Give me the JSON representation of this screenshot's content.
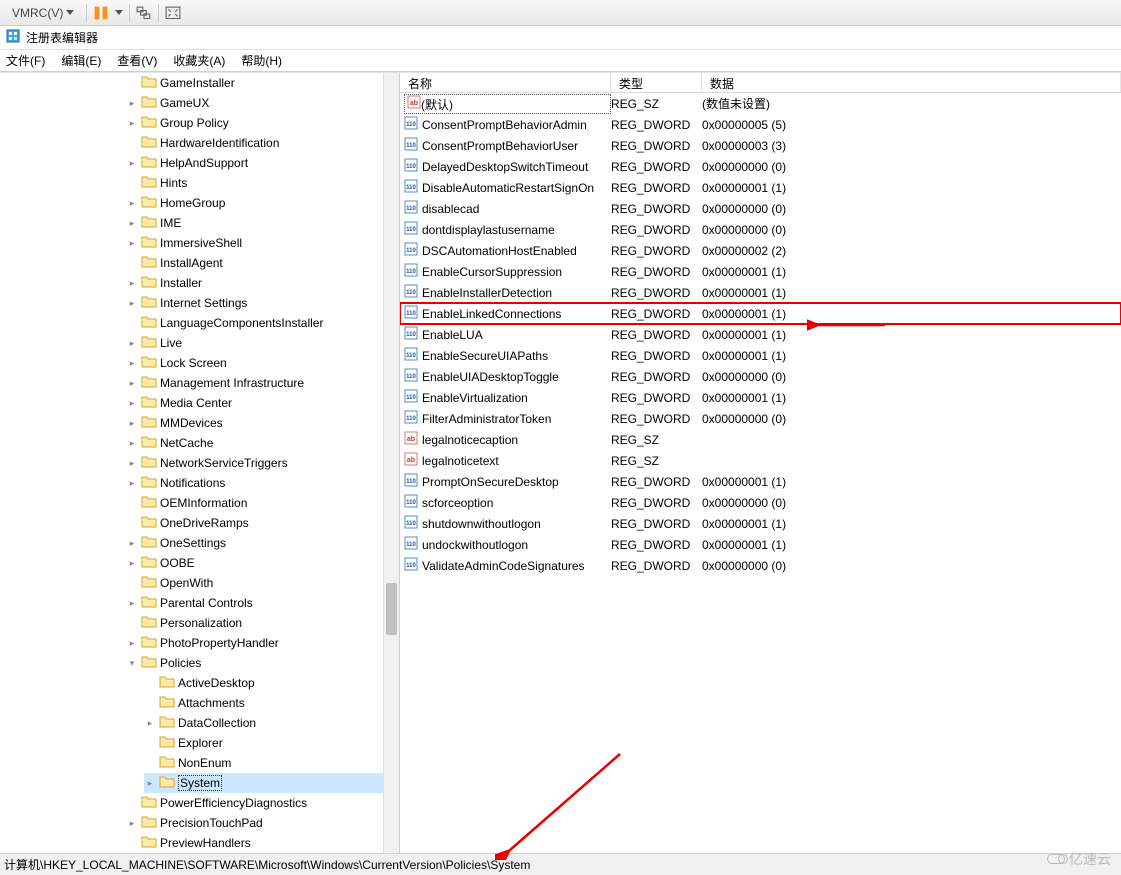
{
  "vmrc": {
    "label": "VMRC(V)"
  },
  "window": {
    "title": "注册表编辑器"
  },
  "menu": {
    "file": "文件(F)",
    "edit": "编辑(E)",
    "view": "查看(V)",
    "favorites": "收藏夹(A)",
    "help": "帮助(H)"
  },
  "tree": {
    "items": [
      {
        "label": "GameInstaller",
        "indent": 1,
        "exp": false
      },
      {
        "label": "GameUX",
        "indent": 1,
        "exp": true
      },
      {
        "label": "Group Policy",
        "indent": 1,
        "exp": true
      },
      {
        "label": "HardwareIdentification",
        "indent": 1,
        "exp": false
      },
      {
        "label": "HelpAndSupport",
        "indent": 1,
        "exp": true
      },
      {
        "label": "Hints",
        "indent": 1,
        "exp": false
      },
      {
        "label": "HomeGroup",
        "indent": 1,
        "exp": true
      },
      {
        "label": "IME",
        "indent": 1,
        "exp": true
      },
      {
        "label": "ImmersiveShell",
        "indent": 1,
        "exp": true
      },
      {
        "label": "InstallAgent",
        "indent": 1,
        "exp": false
      },
      {
        "label": "Installer",
        "indent": 1,
        "exp": true
      },
      {
        "label": "Internet Settings",
        "indent": 1,
        "exp": true
      },
      {
        "label": "LanguageComponentsInstaller",
        "indent": 1,
        "exp": false
      },
      {
        "label": "Live",
        "indent": 1,
        "exp": true
      },
      {
        "label": "Lock Screen",
        "indent": 1,
        "exp": true
      },
      {
        "label": "Management Infrastructure",
        "indent": 1,
        "exp": true
      },
      {
        "label": "Media Center",
        "indent": 1,
        "exp": true
      },
      {
        "label": "MMDevices",
        "indent": 1,
        "exp": true
      },
      {
        "label": "NetCache",
        "indent": 1,
        "exp": true
      },
      {
        "label": "NetworkServiceTriggers",
        "indent": 1,
        "exp": true
      },
      {
        "label": "Notifications",
        "indent": 1,
        "exp": true
      },
      {
        "label": "OEMInformation",
        "indent": 1,
        "exp": false
      },
      {
        "label": "OneDriveRamps",
        "indent": 1,
        "exp": false
      },
      {
        "label": "OneSettings",
        "indent": 1,
        "exp": true
      },
      {
        "label": "OOBE",
        "indent": 1,
        "exp": true
      },
      {
        "label": "OpenWith",
        "indent": 1,
        "exp": false
      },
      {
        "label": "Parental Controls",
        "indent": 1,
        "exp": true
      },
      {
        "label": "Personalization",
        "indent": 1,
        "exp": false
      },
      {
        "label": "PhotoPropertyHandler",
        "indent": 1,
        "exp": true
      },
      {
        "label": "Policies",
        "indent": 1,
        "exp": true,
        "open": true
      },
      {
        "label": "ActiveDesktop",
        "indent": 2,
        "exp": false
      },
      {
        "label": "Attachments",
        "indent": 2,
        "exp": false
      },
      {
        "label": "DataCollection",
        "indent": 2,
        "exp": true
      },
      {
        "label": "Explorer",
        "indent": 2,
        "exp": false
      },
      {
        "label": "NonEnum",
        "indent": 2,
        "exp": false
      },
      {
        "label": "System",
        "indent": 2,
        "exp": true,
        "selected": true
      },
      {
        "label": "PowerEfficiencyDiagnostics",
        "indent": 1,
        "exp": false
      },
      {
        "label": "PrecisionTouchPad",
        "indent": 1,
        "exp": true
      },
      {
        "label": "PreviewHandlers",
        "indent": 1,
        "exp": false
      }
    ]
  },
  "columns": {
    "name": "名称",
    "type": "类型",
    "data": "数据"
  },
  "values": [
    {
      "name": "(默认)",
      "type": "REG_SZ",
      "data": "(数值未设置)",
      "iconType": "sz",
      "selected": true
    },
    {
      "name": "ConsentPromptBehaviorAdmin",
      "type": "REG_DWORD",
      "data": "0x00000005 (5)",
      "iconType": "dw"
    },
    {
      "name": "ConsentPromptBehaviorUser",
      "type": "REG_DWORD",
      "data": "0x00000003 (3)",
      "iconType": "dw"
    },
    {
      "name": "DelayedDesktopSwitchTimeout",
      "type": "REG_DWORD",
      "data": "0x00000000 (0)",
      "iconType": "dw"
    },
    {
      "name": "DisableAutomaticRestartSignOn",
      "type": "REG_DWORD",
      "data": "0x00000001 (1)",
      "iconType": "dw"
    },
    {
      "name": "disablecad",
      "type": "REG_DWORD",
      "data": "0x00000000 (0)",
      "iconType": "dw"
    },
    {
      "name": "dontdisplaylastusername",
      "type": "REG_DWORD",
      "data": "0x00000000 (0)",
      "iconType": "dw"
    },
    {
      "name": "DSCAutomationHostEnabled",
      "type": "REG_DWORD",
      "data": "0x00000002 (2)",
      "iconType": "dw"
    },
    {
      "name": "EnableCursorSuppression",
      "type": "REG_DWORD",
      "data": "0x00000001 (1)",
      "iconType": "dw"
    },
    {
      "name": "EnableInstallerDetection",
      "type": "REG_DWORD",
      "data": "0x00000001 (1)",
      "iconType": "dw"
    },
    {
      "name": "EnableLinkedConnections",
      "type": "REG_DWORD",
      "data": "0x00000001 (1)",
      "iconType": "dw",
      "highlighted": true
    },
    {
      "name": "EnableLUA",
      "type": "REG_DWORD",
      "data": "0x00000001 (1)",
      "iconType": "dw"
    },
    {
      "name": "EnableSecureUIAPaths",
      "type": "REG_DWORD",
      "data": "0x00000001 (1)",
      "iconType": "dw"
    },
    {
      "name": "EnableUIADesktopToggle",
      "type": "REG_DWORD",
      "data": "0x00000000 (0)",
      "iconType": "dw"
    },
    {
      "name": "EnableVirtualization",
      "type": "REG_DWORD",
      "data": "0x00000001 (1)",
      "iconType": "dw"
    },
    {
      "name": "FilterAdministratorToken",
      "type": "REG_DWORD",
      "data": "0x00000000 (0)",
      "iconType": "dw"
    },
    {
      "name": "legalnoticecaption",
      "type": "REG_SZ",
      "data": "",
      "iconType": "sz"
    },
    {
      "name": "legalnoticetext",
      "type": "REG_SZ",
      "data": "",
      "iconType": "sz"
    },
    {
      "name": "PromptOnSecureDesktop",
      "type": "REG_DWORD",
      "data": "0x00000001 (1)",
      "iconType": "dw"
    },
    {
      "name": "scforceoption",
      "type": "REG_DWORD",
      "data": "0x00000000 (0)",
      "iconType": "dw"
    },
    {
      "name": "shutdownwithoutlogon",
      "type": "REG_DWORD",
      "data": "0x00000001 (1)",
      "iconType": "dw"
    },
    {
      "name": "undockwithoutlogon",
      "type": "REG_DWORD",
      "data": "0x00000001 (1)",
      "iconType": "dw"
    },
    {
      "name": "ValidateAdminCodeSignatures",
      "type": "REG_DWORD",
      "data": "0x00000000 (0)",
      "iconType": "dw"
    }
  ],
  "statusbar": {
    "path": "计算机\\HKEY_LOCAL_MACHINE\\SOFTWARE\\Microsoft\\Windows\\CurrentVersion\\Policies\\System"
  },
  "watermark": {
    "text": "亿速云"
  }
}
